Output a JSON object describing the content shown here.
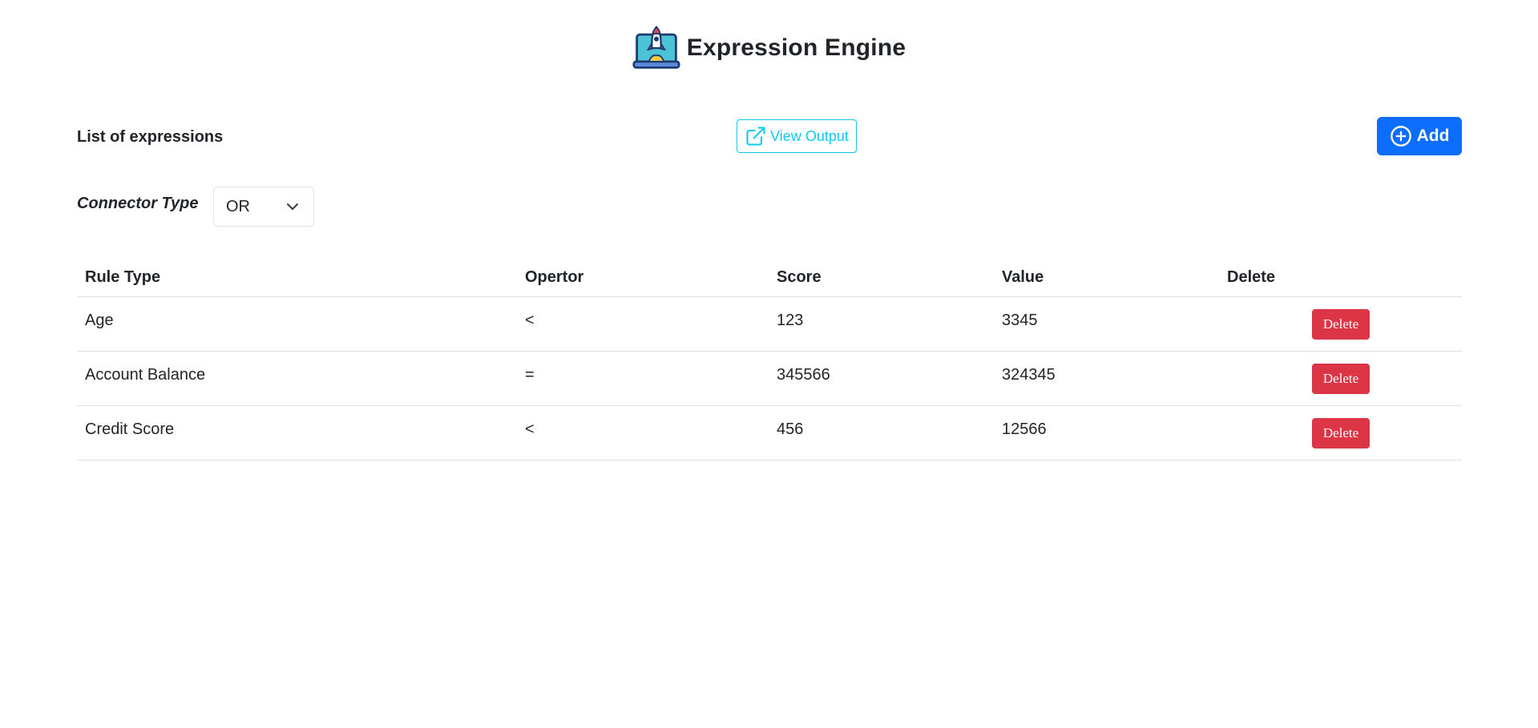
{
  "header": {
    "title": "Expression Engine",
    "logo_icon": "rocket-laptop-icon"
  },
  "toolbar": {
    "list_title": "List of expressions",
    "view_output_label": "View Output",
    "view_output_icon": "external-link-icon",
    "add_label": "Add",
    "add_icon": "plus-circle-icon"
  },
  "connector": {
    "label": "Connector Type",
    "selected": "OR"
  },
  "table": {
    "columns": [
      "Rule Type",
      "Opertor",
      "Score",
      "Value",
      "Delete"
    ],
    "rows": [
      {
        "rule_type": "Age",
        "operator": "<",
        "score": "123",
        "value": "3345",
        "delete_label": "Delete"
      },
      {
        "rule_type": "Account Balance",
        "operator": "=",
        "score": "345566",
        "value": "324345",
        "delete_label": "Delete"
      },
      {
        "rule_type": "Credit Score",
        "operator": "<",
        "score": "456",
        "value": "12566",
        "delete_label": "Delete"
      }
    ]
  },
  "colors": {
    "primary": "#0d6efd",
    "info": "#0dcaf0",
    "danger": "#dc3545",
    "text": "#212529",
    "border": "#dee2e6"
  }
}
